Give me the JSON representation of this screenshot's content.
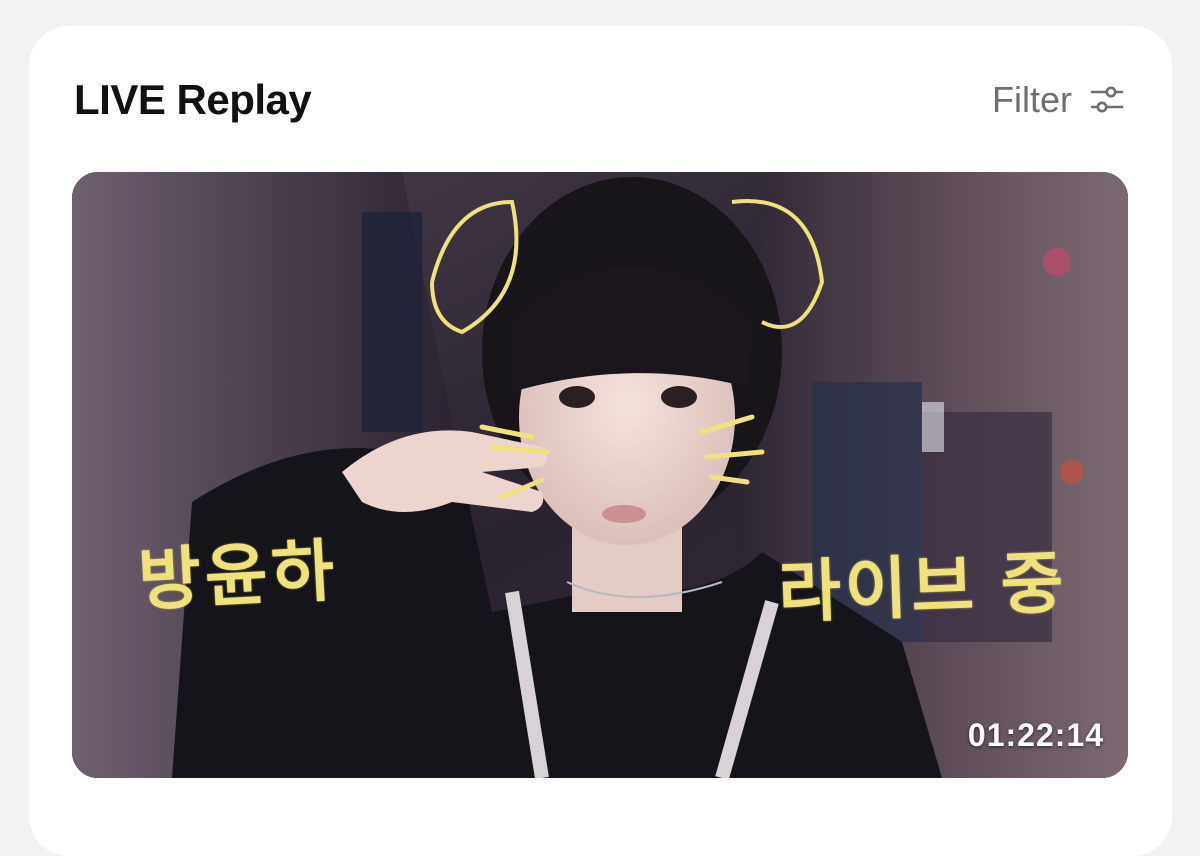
{
  "section": {
    "title": "LIVE Replay",
    "filter_label": "Filter",
    "filter_icon": "sliders-icon"
  },
  "video": {
    "overlay_text_left": "방윤하",
    "overlay_text_right": "라이브 중",
    "duration": "01:22:14"
  },
  "colors": {
    "card_background": "#ffffff",
    "page_background": "#f2f2f4",
    "title": "#111111",
    "filter": "#6e6e73",
    "doodle": "#efe27a"
  }
}
